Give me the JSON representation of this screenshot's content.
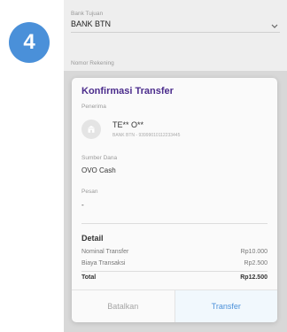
{
  "step": {
    "number": "4"
  },
  "form": {
    "bank_label": "Bank Tujuan",
    "bank_value": "BANK BTN",
    "account_label": "Nomor Rekening"
  },
  "dialog": {
    "title": "Konfirmasi Transfer",
    "recipient_label": "Penerima",
    "recipient_name": "TE** O**",
    "recipient_account": "BANK BTN - 93999010112233445",
    "source_label": "Sumber Dana",
    "source_value": "OVO Cash",
    "message_label": "Pesan",
    "message_value": "-",
    "detail_title": "Detail",
    "rows": [
      {
        "label": "Nominal Transfer",
        "value": "Rp10.000"
      },
      {
        "label": "Biaya Transaksi",
        "value": "Rp2.500"
      }
    ],
    "total_label": "Total",
    "total_value": "Rp12.500",
    "cancel_label": "Batalkan",
    "transfer_label": "Transfer"
  },
  "colors": {
    "accent": "#4a90d9",
    "title": "#4b2c8c"
  }
}
